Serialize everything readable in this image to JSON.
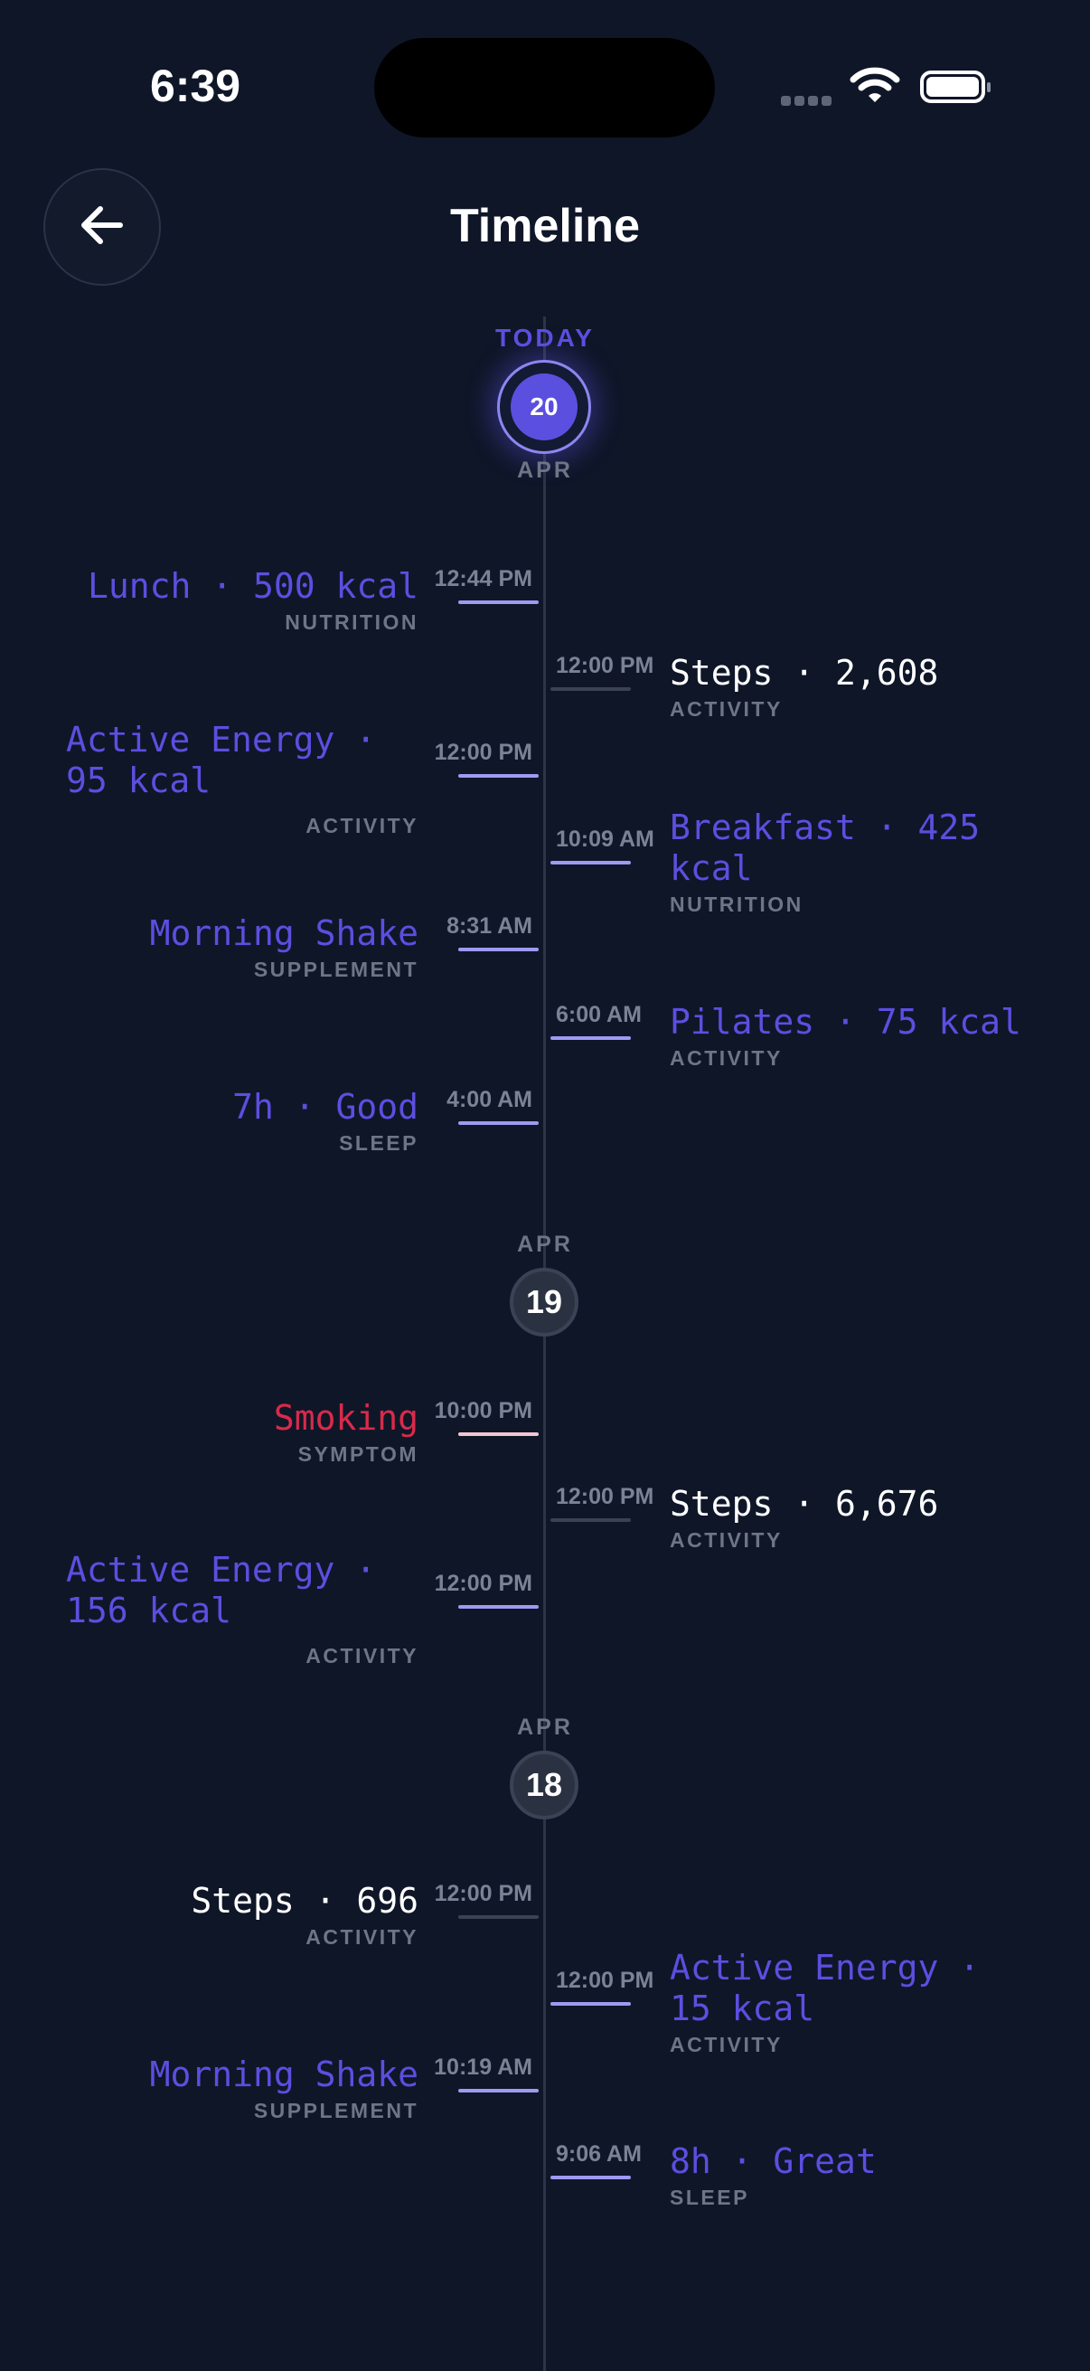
{
  "status_bar": {
    "time": "6:39"
  },
  "header": {
    "title": "Timeline"
  },
  "icons": {
    "back": "arrow-left-icon",
    "wifi": "wifi-icon",
    "battery": "battery-icon",
    "signal": "signal-dots-icon"
  },
  "days": {
    "apr20": {
      "today_label": "TODAY",
      "day": "20",
      "month": "APR"
    },
    "apr19": {
      "month": "APR",
      "day": "19"
    },
    "apr18": {
      "month": "APR",
      "day": "18"
    }
  },
  "entries": {
    "e1": {
      "time": "12:44 PM",
      "title": "Lunch · 500 kcal",
      "category": "NUTRITION"
    },
    "e2": {
      "time": "12:00 PM",
      "title": "Steps · 2,608",
      "category": "ACTIVITY"
    },
    "e3": {
      "time": "12:00 PM",
      "title": "Active Energy · 95 kcal",
      "category": "ACTIVITY"
    },
    "e4": {
      "time": "10:09 AM",
      "title": "Breakfast · 425 kcal",
      "category": "NUTRITION"
    },
    "e5": {
      "time": "8:31 AM",
      "title": "Morning Shake",
      "category": "SUPPLEMENT"
    },
    "e6": {
      "time": "6:00 AM",
      "title": "Pilates · 75 kcal",
      "category": "ACTIVITY"
    },
    "e7": {
      "time": "4:00 AM",
      "title": "7h · Good",
      "category": "SLEEP"
    },
    "e8": {
      "time": "10:00 PM",
      "title": "Smoking",
      "category": "SYMPTOM"
    },
    "e9": {
      "time": "12:00 PM",
      "title": "Steps · 6,676",
      "category": "ACTIVITY"
    },
    "e10": {
      "time": "12:00 PM",
      "title": "Active Energy · 156 kcal",
      "category": "ACTIVITY"
    },
    "e11": {
      "time": "12:00 PM",
      "title": "Steps · 696",
      "category": "ACTIVITY"
    },
    "e12": {
      "time": "12:00 PM",
      "title": "Active Energy · 15 kcal",
      "category": "ACTIVITY"
    },
    "e13": {
      "time": "10:19 AM",
      "title": "Morning Shake",
      "category": "SUPPLEMENT"
    },
    "e14": {
      "time": "9:06 AM",
      "title": "8h · Great",
      "category": "SLEEP"
    }
  },
  "colors": {
    "background": "#0f1628",
    "accent": "#5b4fe0",
    "symptom": "#d92a4a",
    "muted": "#6d7587"
  }
}
